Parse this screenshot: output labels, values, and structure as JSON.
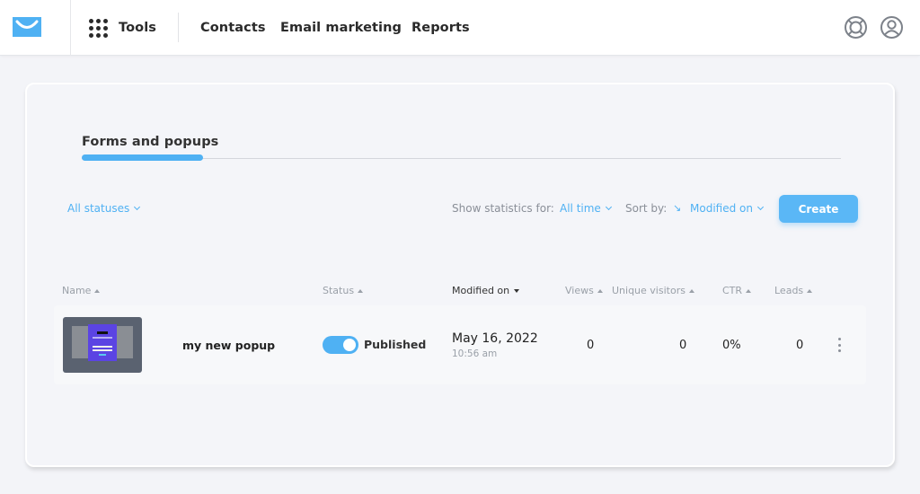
{
  "header": {
    "brand_color": "#4fb1f3",
    "logo_icon": "envelope-smile-logo",
    "tools_label": "Tools",
    "nav": [
      {
        "label": "Contacts"
      },
      {
        "label": "Email marketing"
      },
      {
        "label": "Reports"
      }
    ],
    "icons": {
      "help": "lifebuoy-icon",
      "account": "user-circle-icon"
    }
  },
  "page": {
    "tab_title": "Forms and popups",
    "filters": {
      "status_filter": "All statuses",
      "stats_label": "Show statistics for:",
      "stats_period": "All time",
      "sort_label": "Sort by:",
      "sort_direction_glyph": "↘",
      "sort_field": "Modified on"
    },
    "create_label": "Create",
    "table": {
      "columns": [
        {
          "label": "Name",
          "sort": "asc"
        },
        {
          "label": "Status",
          "sort": "asc"
        },
        {
          "label": "Modified on",
          "sort": "desc",
          "active": true
        },
        {
          "label": "Views",
          "sort": "asc"
        },
        {
          "label": "Unique visitors",
          "sort": "asc"
        },
        {
          "label": "CTR",
          "sort": "asc"
        },
        {
          "label": "Leads",
          "sort": "asc"
        }
      ],
      "rows": [
        {
          "name": "my new popup",
          "published": true,
          "status": "Published",
          "modified_date": "May 16, 2022",
          "modified_time": "10:56 am",
          "views": "0",
          "unique_visitors": "0",
          "ctr": "0%",
          "leads": "0"
        }
      ]
    }
  }
}
